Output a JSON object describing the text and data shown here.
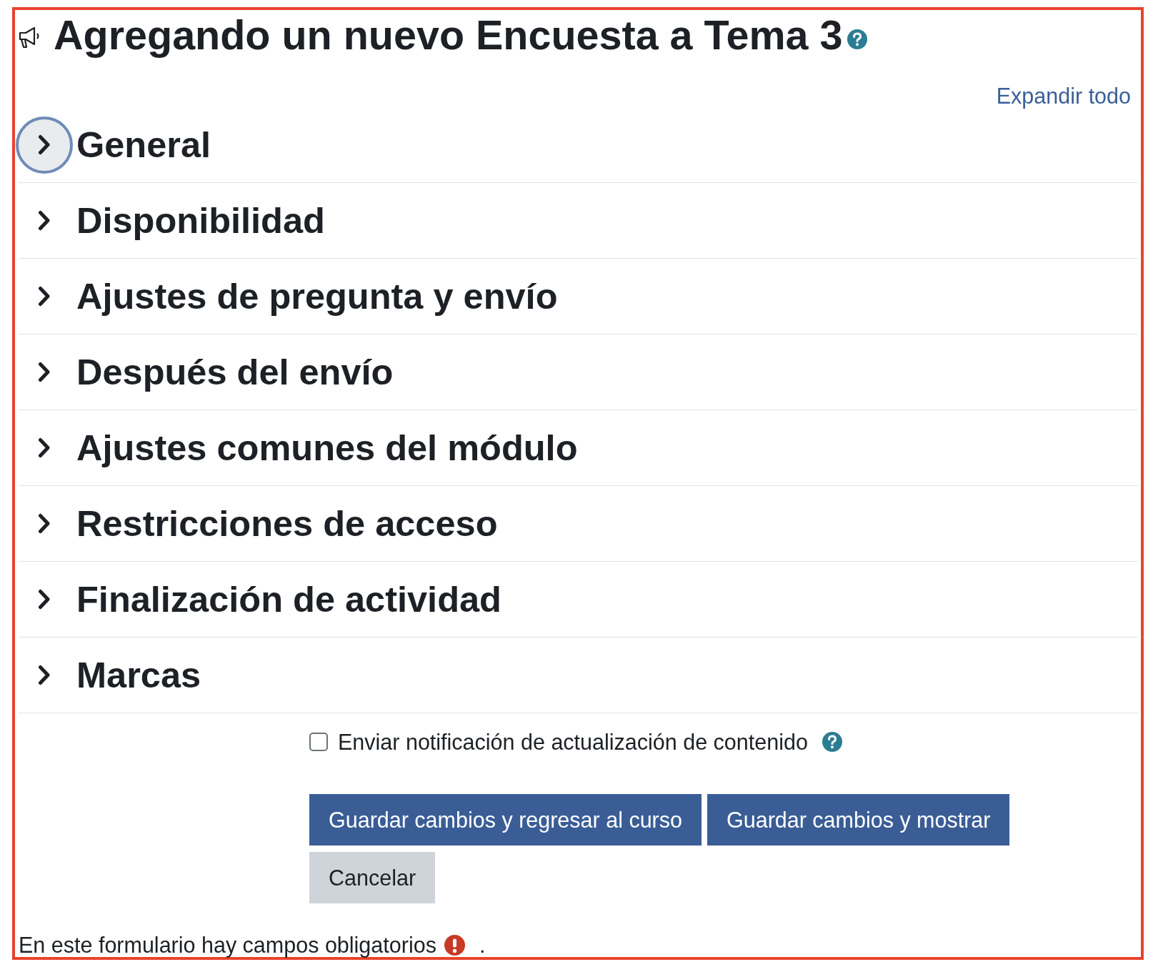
{
  "page": {
    "title": "Agregando un nuevo Encuesta a Tema 3",
    "expand_all": "Expandir todo"
  },
  "sections": [
    {
      "title": "General",
      "expanded": false,
      "focused": true
    },
    {
      "title": "Disponibilidad",
      "expanded": false,
      "focused": false
    },
    {
      "title": "Ajustes de pregunta y envío",
      "expanded": false,
      "focused": false
    },
    {
      "title": "Después del envío",
      "expanded": false,
      "focused": false
    },
    {
      "title": "Ajustes comunes del módulo",
      "expanded": false,
      "focused": false
    },
    {
      "title": "Restricciones de acceso",
      "expanded": false,
      "focused": false
    },
    {
      "title": "Finalización de actividad",
      "expanded": false,
      "focused": false
    },
    {
      "title": "Marcas",
      "expanded": false,
      "focused": false
    }
  ],
  "notify_checkbox": {
    "label": "Enviar notificación de actualización de contenido",
    "checked": false
  },
  "buttons": [
    {
      "label": "Guardar cambios y regresar al curso",
      "kind": "primary"
    },
    {
      "label": "Guardar cambios y mostrar",
      "kind": "primary"
    },
    {
      "label": "Cancelar",
      "kind": "secondary"
    }
  ],
  "required_note": {
    "text": "En este formulario hay campos obligatorios",
    "suffix": "."
  }
}
